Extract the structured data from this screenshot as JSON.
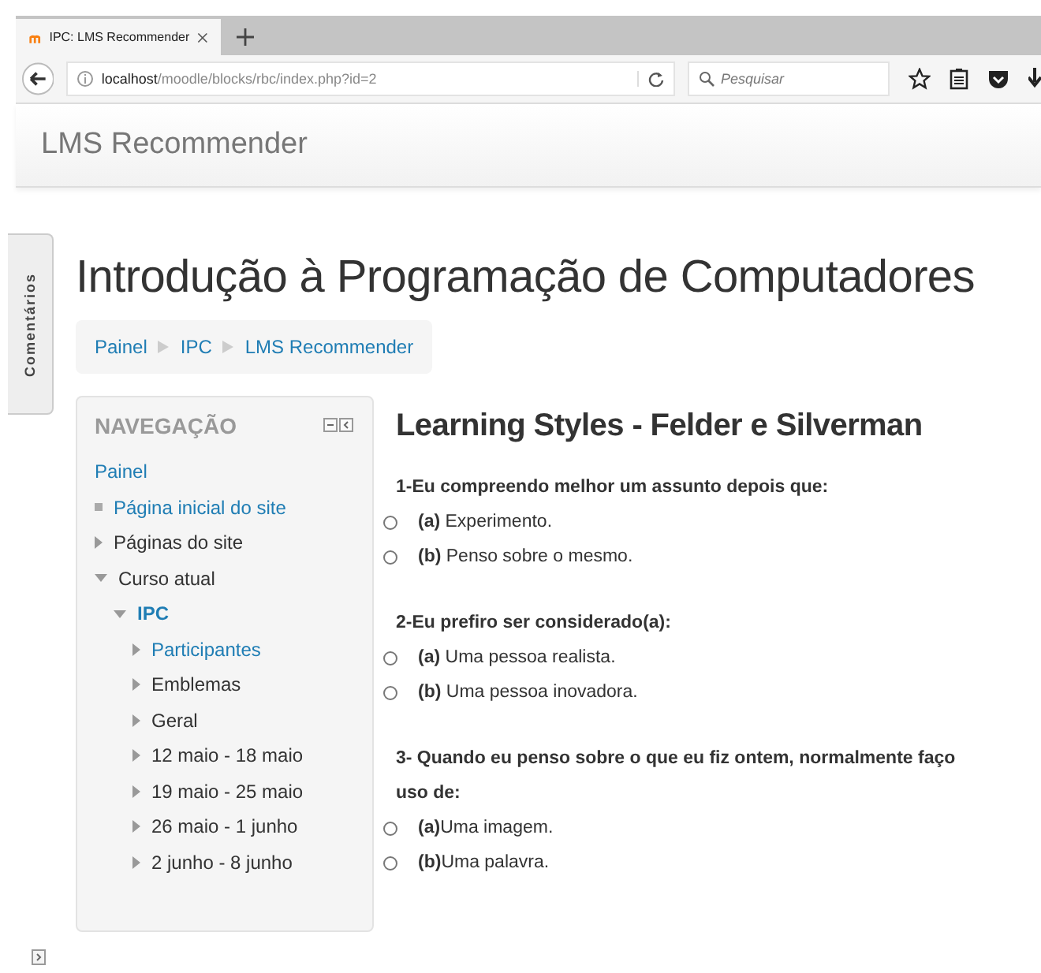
{
  "browser": {
    "tab": {
      "title": "IPC: LMS Recommender",
      "selected": true
    },
    "url_host": "localhost",
    "url_path": "/moodle/blocks/rbc/index.php?id=2",
    "search": {
      "placeholder": "Pesquisar"
    }
  },
  "site_name": "LMS Recommender",
  "side_tab": "Comentários",
  "page_title": "Introdução à Programação de Computadores",
  "breadcrumb": [
    "Painel",
    "IPC",
    "LMS Recommender"
  ],
  "navigation": {
    "title": "NAVEGAÇÃO",
    "items": [
      {
        "label": "Painel",
        "kind": "root",
        "link": true
      },
      {
        "label": "Página inicial do site",
        "kind": "leaf",
        "link": true
      },
      {
        "label": "Páginas do site",
        "kind": "branch",
        "link": false,
        "expanded": false
      },
      {
        "label": "Curso atual",
        "kind": "branch",
        "link": false,
        "expanded": true,
        "children": [
          {
            "label": "IPC",
            "kind": "branch",
            "link": true,
            "current": true,
            "expanded": true,
            "children": [
              {
                "label": "Participantes",
                "kind": "branch",
                "link": true,
                "expanded": false
              },
              {
                "label": "Emblemas",
                "kind": "branch",
                "link": false,
                "expanded": false
              },
              {
                "label": "Geral",
                "kind": "branch",
                "link": false,
                "expanded": false
              },
              {
                "label": "12 maio - 18 maio",
                "kind": "branch",
                "link": false,
                "expanded": false
              },
              {
                "label": "19 maio - 25 maio",
                "kind": "branch",
                "link": false,
                "expanded": false
              },
              {
                "label": "26 maio - 1 junho",
                "kind": "branch",
                "link": false,
                "expanded": false
              },
              {
                "label": "2 junho - 8 junho",
                "kind": "branch",
                "link": false,
                "expanded": false
              }
            ]
          }
        ]
      }
    ]
  },
  "quiz": {
    "title": "Learning Styles - Felder e Silverman",
    "questions": [
      {
        "text": "1-Eu compreendo melhor um assunto depois que:",
        "options": [
          {
            "label": "**(a)** Experimento.",
            "selected": false
          },
          {
            "label": "**(b)** Penso sobre o mesmo.",
            "selected": false
          }
        ]
      },
      {
        "text": "2-Eu prefiro ser considerado(a):",
        "options": [
          {
            "label": "**(a)** Uma pessoa realista.",
            "selected": false
          },
          {
            "label": "**(b)** Uma pessoa inovadora.",
            "selected": false
          }
        ]
      },
      {
        "text": "3- Quando eu penso sobre o que eu fiz ontem, normalmente faço uso de:",
        "options": [
          {
            "label": "**(a)**Uma imagem.",
            "selected": false
          },
          {
            "label": "**(b)**Uma palavra.",
            "selected": false
          }
        ]
      }
    ]
  }
}
